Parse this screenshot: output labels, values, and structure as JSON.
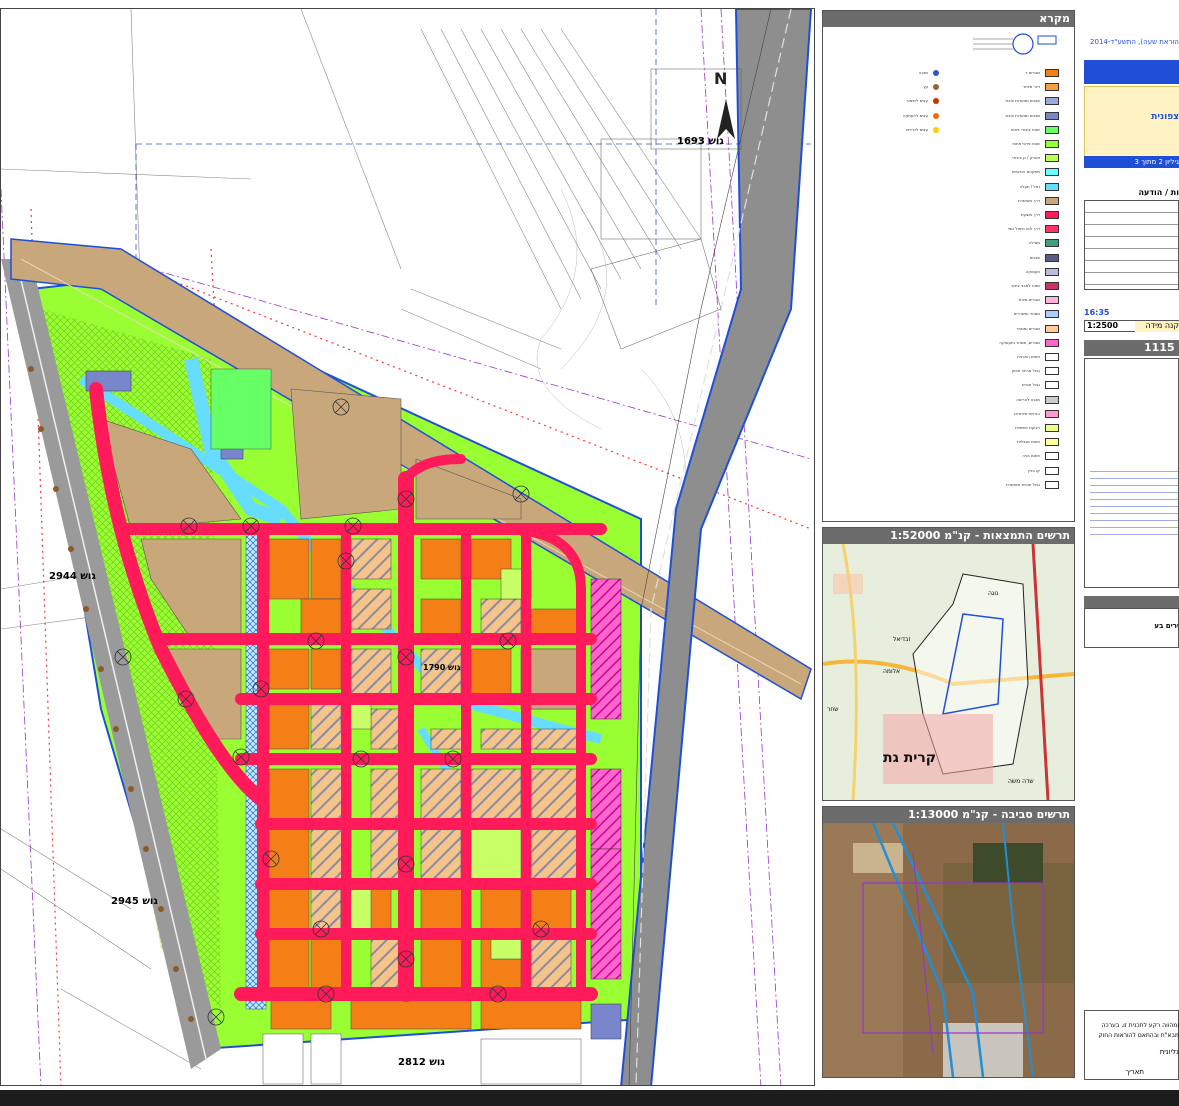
{
  "map": {
    "block_labels": [
      "גוש 1693",
      "גוש 2944",
      "גוש 2945",
      "גוש 2812",
      "גוש 1790"
    ],
    "north_label": "N"
  },
  "legend": {
    "title": "מקרא",
    "items": [
      {
        "label": "מגורים ד",
        "color": "#f57f17"
      },
      {
        "label": "דיור מיוחד",
        "color": "#f5a142"
      },
      {
        "label": "מבנים ומוסדות ציבור",
        "color": "#9fa8da"
      },
      {
        "label": "מבנים ומוסדות ציבור",
        "color": "#7986cb"
      },
      {
        "label": "שטח ציבורי פתוח",
        "color": "#66ff66"
      },
      {
        "label": "שטח פרטי פתוח",
        "color": "#99ff33"
      },
      {
        "label": "פארק / גן ציבורי",
        "color": "#bbff55"
      },
      {
        "label": "מתקנים הנדסיים",
        "color": "#66ffff"
      },
      {
        "label": "נחל / תעלה",
        "color": "#66ddff"
      },
      {
        "label": "דרך מאושרת",
        "color": "#c8a77a"
      },
      {
        "label": "דרך מוצעת",
        "color": "#ff1a5a"
      },
      {
        "label": "דרך ו/או טיפול נופי",
        "color": "#ff3366"
      },
      {
        "label": "מסילה",
        "color": "#3f9f7f"
      },
      {
        "label": "מבנים",
        "color": "#5c5c8a"
      },
      {
        "label": "תעסוקה",
        "color": "#bbbbdd"
      },
      {
        "label": "שטח למבני ציבור",
        "color": "#cc3366"
      },
      {
        "label": "מגורים מיוחד",
        "color": "#ffb3d9"
      },
      {
        "label": "מסחר ומשרדים",
        "color": "#aaccff"
      },
      {
        "label": "מגורים ומסחר",
        "color": "#ffcc99"
      },
      {
        "label": "מגורים, מסחר ותעסוקה",
        "color": "#ff66cc"
      },
      {
        "label": "תחום התכנית",
        "color": "#ffffff"
      },
      {
        "label": "גבול מרחב תכנון",
        "color": "#ffffff"
      },
      {
        "label": "גבול מגרש",
        "color": "#ffffff"
      },
      {
        "label": "מבנה להריסה",
        "color": "#cccccc"
      },
      {
        "label": "הנחיות מיוחדות",
        "color": "#ff99cc"
      },
      {
        "label": "רצועת תשתיות",
        "color": "#eeff88"
      },
      {
        "label": "תחום מגבלות",
        "color": "#ffff99"
      },
      {
        "label": "תחום בניה",
        "color": "#ffffff"
      },
      {
        "label": "קו בניין",
        "color": "#ffffff"
      },
      {
        "label": "גבול תכנית מאושרת",
        "color": "#ffffff"
      }
    ],
    "point_items": [
      {
        "label": "מבנה",
        "color": "#3355cc"
      },
      {
        "label": "עץ",
        "color": "#996633"
      },
      {
        "label": "עצים לשימור",
        "color": "#cc3300"
      },
      {
        "label": "עצים להעתקה",
        "color": "#ff6600"
      },
      {
        "label": "עצים לכריתה",
        "color": "#ffcc00"
      }
    ]
  },
  "location_map": {
    "title": "תרשים התמצאות - קנ\"מ 1:52000",
    "labels": [
      "קרית גת",
      "שדה משה",
      "אלומה",
      "נוגה",
      "זבדיאל",
      "שחר"
    ]
  },
  "surroundings_map": {
    "title": "תרשים סביבה - קנ\"מ 1:13000"
  },
  "info_panel": {
    "law_text": "הוראת שעה), התשע\"ד-2014",
    "northern": "צפונית",
    "sheet": "גיליון 2 מתוך 3",
    "version_label": "ות / הודעה",
    "time": "16:35",
    "scale_label": "קנה מידה",
    "scale_value": "1:2500",
    "plan_number": "1115",
    "council": "ירים בע",
    "footer_1": "ומהווה רקע לתכנית זו, בערכה",
    "footer_2": "מבא\"ת ובהתאם להוראות החוק",
    "footer_3": "גליונית",
    "date_label": "תאריך"
  },
  "colors": {
    "residential": "#f57f17",
    "road": "#ff1a5a",
    "open_space": "#99ff33",
    "public_space": "#66ff66",
    "existing_road": "#c8a77a",
    "water": "#66ddff",
    "plan_boundary": "#1f4fd6",
    "railway": "#808080"
  }
}
